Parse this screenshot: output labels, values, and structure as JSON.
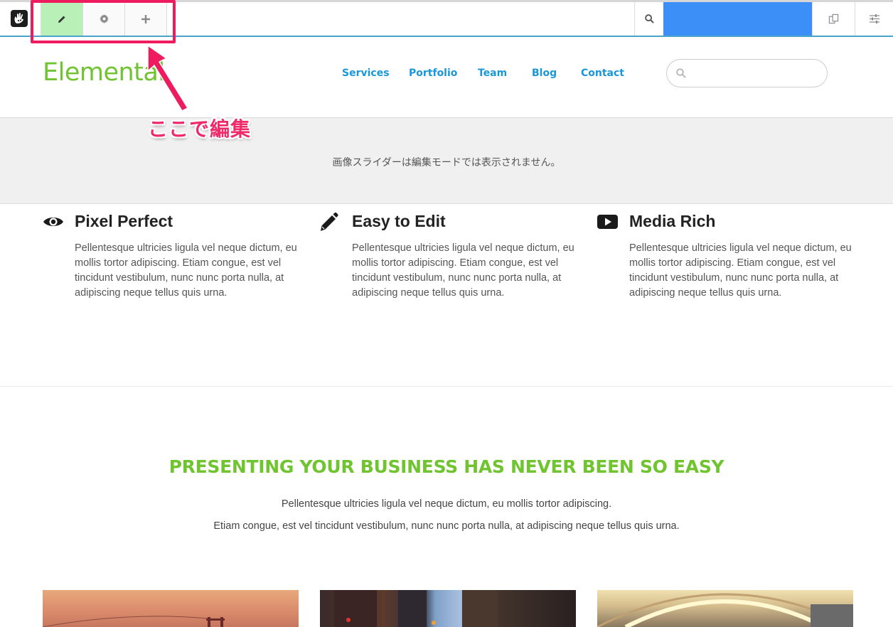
{
  "toolbar": {
    "logo_icon": "concrete5-hand-icon",
    "edit_icon": "pencil-icon",
    "settings_icon": "gear-icon",
    "add_icon": "plus-icon",
    "search_icon": "search-icon",
    "search_value": "",
    "pages_icon": "pages-icon",
    "settings_panel_icon": "sliders-icon",
    "edit_active_color": "#b8f0b8",
    "search_bar_color": "#3b8ff6"
  },
  "annotation": {
    "text": "ここで編集",
    "color": "#ee2a6a"
  },
  "header": {
    "logo": "Elemental",
    "nav": [
      {
        "label": "Services"
      },
      {
        "label": "Portfolio"
      },
      {
        "label": "Team"
      },
      {
        "label": "Blog"
      },
      {
        "label": "Contact"
      }
    ],
    "search_placeholder": "",
    "brand_color": "#6fc42f",
    "nav_color": "#1a97d6"
  },
  "slider": {
    "message": "画像スライダーは編集モードでは表示されません。"
  },
  "features": [
    {
      "icon": "eye-icon",
      "title": "Pixel Perfect",
      "text": "Pellentesque ultricies ligula vel neque dictum, eu mollis tortor adipiscing. Etiam congue, est vel tincidunt vestibulum, nunc nunc porta nulla, at adipiscing neque tellus quis urna."
    },
    {
      "icon": "pencil-icon",
      "title": "Easy to Edit",
      "text": "Pellentesque ultricies ligula vel neque dictum, eu mollis tortor adipiscing. Etiam congue, est vel tincidunt vestibulum, nunc nunc porta nulla, at adipiscing neque tellus quis urna."
    },
    {
      "icon": "play-icon",
      "title": "Media Rich",
      "text": "Pellentesque ultricies ligula vel neque dictum, eu mollis tortor adipiscing. Etiam congue, est vel tincidunt vestibulum, nunc nunc porta nulla, at adipiscing neque tellus quis urna."
    }
  ],
  "present": {
    "title": "PRESENTING YOUR BUSINESS HAS NEVER BEEN SO EASY",
    "line1": "Pellentesque ultricies ligula vel neque dictum, eu mollis tortor adipiscing.",
    "line2": "Etiam congue, est vel tincidunt vestibulum, nunc nunc porta nulla, at adipiscing neque tellus quis urna."
  }
}
